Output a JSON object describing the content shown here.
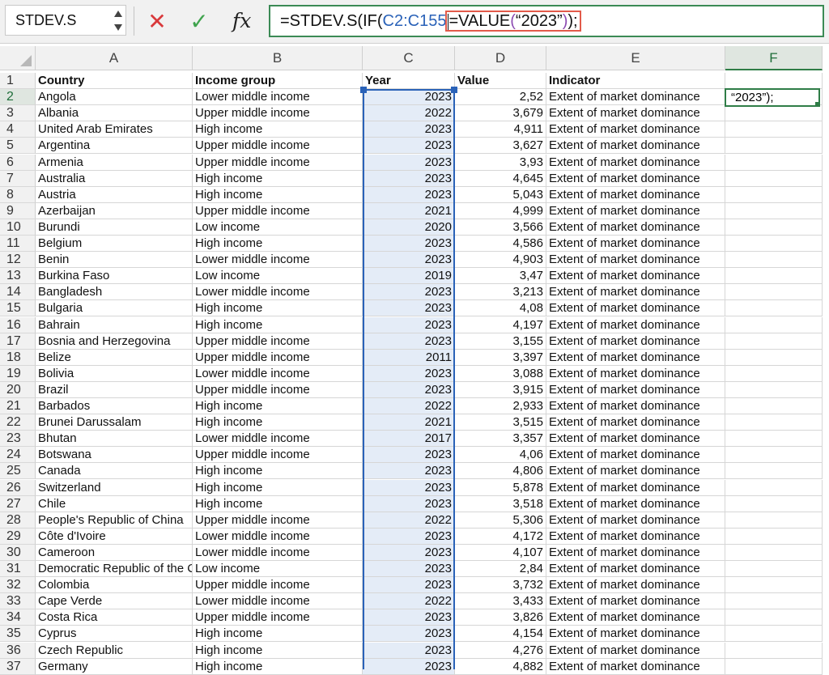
{
  "formula_bar": {
    "name_box": "STDEV.S",
    "cancel_icon": "✕",
    "enter_icon": "✓",
    "fx_label": "fx",
    "formula_prefix": "=STDEV.S(IF(",
    "formula_range": "C2:C155",
    "formula_eq": "=VALUE",
    "formula_open_paren": "(",
    "formula_string": "“2023”",
    "formula_close_paren": ")",
    "formula_tail": ");"
  },
  "colors": {
    "range_ref": "#2a62b8",
    "paren": "#8d4bb2",
    "highlight_box": "#e25a4a",
    "accent_green": "#2f7d47"
  },
  "columns": [
    "A",
    "B",
    "C",
    "D",
    "E",
    "F"
  ],
  "selected_column": "F",
  "edit_cell_text": "“2023”);",
  "rows": [
    {
      "n": "1",
      "a": "Country",
      "b": "Income group",
      "c": "Year",
      "d": "Value",
      "e": "Indicator"
    },
    {
      "n": "2",
      "a": "Angola",
      "b": "Lower middle income",
      "c": "2023",
      "d": "2,52",
      "e": "Extent of market dominance"
    },
    {
      "n": "3",
      "a": "Albania",
      "b": "Upper middle income",
      "c": "2022",
      "d": "3,679",
      "e": "Extent of market dominance"
    },
    {
      "n": "4",
      "a": "United Arab Emirates",
      "b": "High income",
      "c": "2023",
      "d": "4,911",
      "e": "Extent of market dominance"
    },
    {
      "n": "5",
      "a": "Argentina",
      "b": "Upper middle income",
      "c": "2023",
      "d": "3,627",
      "e": "Extent of market dominance"
    },
    {
      "n": "6",
      "a": "Armenia",
      "b": "Upper middle income",
      "c": "2023",
      "d": "3,93",
      "e": "Extent of market dominance"
    },
    {
      "n": "7",
      "a": "Australia",
      "b": "High income",
      "c": "2023",
      "d": "4,645",
      "e": "Extent of market dominance"
    },
    {
      "n": "8",
      "a": "Austria",
      "b": "High income",
      "c": "2023",
      "d": "5,043",
      "e": "Extent of market dominance"
    },
    {
      "n": "9",
      "a": "Azerbaijan",
      "b": "Upper middle income",
      "c": "2021",
      "d": "4,999",
      "e": "Extent of market dominance"
    },
    {
      "n": "10",
      "a": "Burundi",
      "b": "Low income",
      "c": "2020",
      "d": "3,566",
      "e": "Extent of market dominance"
    },
    {
      "n": "11",
      "a": "Belgium",
      "b": "High income",
      "c": "2023",
      "d": "4,586",
      "e": "Extent of market dominance"
    },
    {
      "n": "12",
      "a": "Benin",
      "b": "Lower middle income",
      "c": "2023",
      "d": "4,903",
      "e": "Extent of market dominance"
    },
    {
      "n": "13",
      "a": "Burkina Faso",
      "b": "Low income",
      "c": "2019",
      "d": "3,47",
      "e": "Extent of market dominance"
    },
    {
      "n": "14",
      "a": "Bangladesh",
      "b": "Lower middle income",
      "c": "2023",
      "d": "3,213",
      "e": "Extent of market dominance"
    },
    {
      "n": "15",
      "a": "Bulgaria",
      "b": "High income",
      "c": "2023",
      "d": "4,08",
      "e": "Extent of market dominance"
    },
    {
      "n": "16",
      "a": "Bahrain",
      "b": "High income",
      "c": "2023",
      "d": "4,197",
      "e": "Extent of market dominance"
    },
    {
      "n": "17",
      "a": "Bosnia and Herzegovina",
      "b": "Upper middle income",
      "c": "2023",
      "d": "3,155",
      "e": "Extent of market dominance"
    },
    {
      "n": "18",
      "a": "Belize",
      "b": "Upper middle income",
      "c": "2011",
      "d": "3,397",
      "e": "Extent of market dominance"
    },
    {
      "n": "19",
      "a": "Bolivia",
      "b": "Lower middle income",
      "c": "2023",
      "d": "3,088",
      "e": "Extent of market dominance"
    },
    {
      "n": "20",
      "a": "Brazil",
      "b": "Upper middle income",
      "c": "2023",
      "d": "3,915",
      "e": "Extent of market dominance"
    },
    {
      "n": "21",
      "a": "Barbados",
      "b": "High income",
      "c": "2022",
      "d": "2,933",
      "e": "Extent of market dominance"
    },
    {
      "n": "22",
      "a": "Brunei Darussalam",
      "b": "High income",
      "c": "2021",
      "d": "3,515",
      "e": "Extent of market dominance"
    },
    {
      "n": "23",
      "a": "Bhutan",
      "b": "Lower middle income",
      "c": "2017",
      "d": "3,357",
      "e": "Extent of market dominance"
    },
    {
      "n": "24",
      "a": "Botswana",
      "b": "Upper middle income",
      "c": "2023",
      "d": "4,06",
      "e": "Extent of market dominance"
    },
    {
      "n": "25",
      "a": "Canada",
      "b": "High income",
      "c": "2023",
      "d": "4,806",
      "e": "Extent of market dominance"
    },
    {
      "n": "26",
      "a": "Switzerland",
      "b": "High income",
      "c": "2023",
      "d": "5,878",
      "e": "Extent of market dominance"
    },
    {
      "n": "27",
      "a": "Chile",
      "b": "High income",
      "c": "2023",
      "d": "3,518",
      "e": "Extent of market dominance"
    },
    {
      "n": "28",
      "a": "People's Republic of China",
      "b": "Upper middle income",
      "c": "2022",
      "d": "5,306",
      "e": "Extent of market dominance"
    },
    {
      "n": "29",
      "a": "Côte d'Ivoire",
      "b": "Lower middle income",
      "c": "2023",
      "d": "4,172",
      "e": "Extent of market dominance"
    },
    {
      "n": "30",
      "a": "Cameroon",
      "b": "Lower middle income",
      "c": "2023",
      "d": "4,107",
      "e": "Extent of market dominance"
    },
    {
      "n": "31",
      "a": "Democratic Republic of the Congo",
      "b": "Low income",
      "c": "2023",
      "d": "2,84",
      "e": "Extent of market dominance"
    },
    {
      "n": "32",
      "a": "Colombia",
      "b": "Upper middle income",
      "c": "2023",
      "d": "3,732",
      "e": "Extent of market dominance"
    },
    {
      "n": "33",
      "a": "Cape Verde",
      "b": "Lower middle income",
      "c": "2022",
      "d": "3,433",
      "e": "Extent of market dominance"
    },
    {
      "n": "34",
      "a": "Costa Rica",
      "b": "Upper middle income",
      "c": "2023",
      "d": "3,826",
      "e": "Extent of market dominance"
    },
    {
      "n": "35",
      "a": "Cyprus",
      "b": "High income",
      "c": "2023",
      "d": "4,154",
      "e": "Extent of market dominance"
    },
    {
      "n": "36",
      "a": "Czech Republic",
      "b": "High income",
      "c": "2023",
      "d": "4,276",
      "e": "Extent of market dominance"
    },
    {
      "n": "37",
      "a": "Germany",
      "b": "High income",
      "c": "2023",
      "d": "4,882",
      "e": "Extent of market dominance"
    }
  ]
}
